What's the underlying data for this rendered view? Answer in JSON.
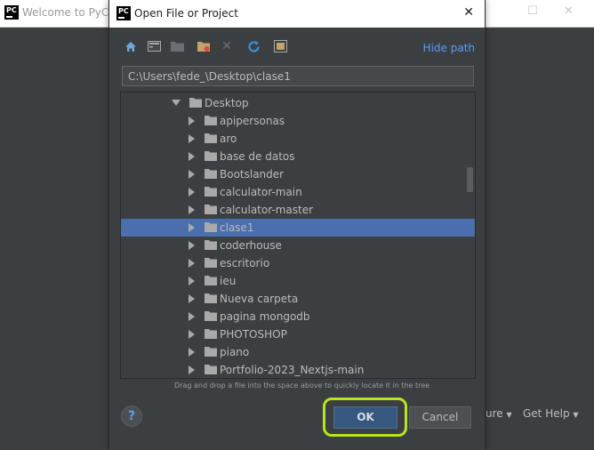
{
  "background": {
    "window_title": "Welcome to PyCh",
    "app_logo": "PC",
    "footer_configure": "ure",
    "footer_help": "Get Help"
  },
  "dialog": {
    "title": "Open File or Project",
    "logo": "PC",
    "hide_path": "Hide path",
    "path_value": "C:\\Users\\fede_\\Desktop\\clase1",
    "toolbar_icons": [
      "home-icon",
      "desktop-icon",
      "project-folder-icon",
      "new-folder-icon",
      "delete-icon",
      "refresh-icon",
      "show-hidden-icon"
    ],
    "tree": {
      "parent": "Desktop",
      "items": [
        {
          "label": "apipersonas",
          "selected": false
        },
        {
          "label": "aro",
          "selected": false
        },
        {
          "label": "base de datos",
          "selected": false
        },
        {
          "label": "Bootslander",
          "selected": false
        },
        {
          "label": "calculator-main",
          "selected": false
        },
        {
          "label": "calculator-master",
          "selected": false
        },
        {
          "label": "clase1",
          "selected": true
        },
        {
          "label": "coderhouse",
          "selected": false
        },
        {
          "label": "escritorio",
          "selected": false
        },
        {
          "label": "ieu",
          "selected": false
        },
        {
          "label": "Nueva carpeta",
          "selected": false
        },
        {
          "label": "pagina mongodb",
          "selected": false
        },
        {
          "label": "PHOTOSHOP",
          "selected": false
        },
        {
          "label": "piano",
          "selected": false
        },
        {
          "label": "Portfolio-2023_Nextjs-main",
          "selected": false
        }
      ]
    },
    "drag_hint": "Drag and drop a file into the space above to quickly locate it in the tree",
    "ok_label": "OK",
    "cancel_label": "Cancel",
    "help_label": "?"
  },
  "colors": {
    "accent": "#589df6",
    "selection": "#4b6eaf",
    "highlight_ring": "#b6e61c"
  }
}
